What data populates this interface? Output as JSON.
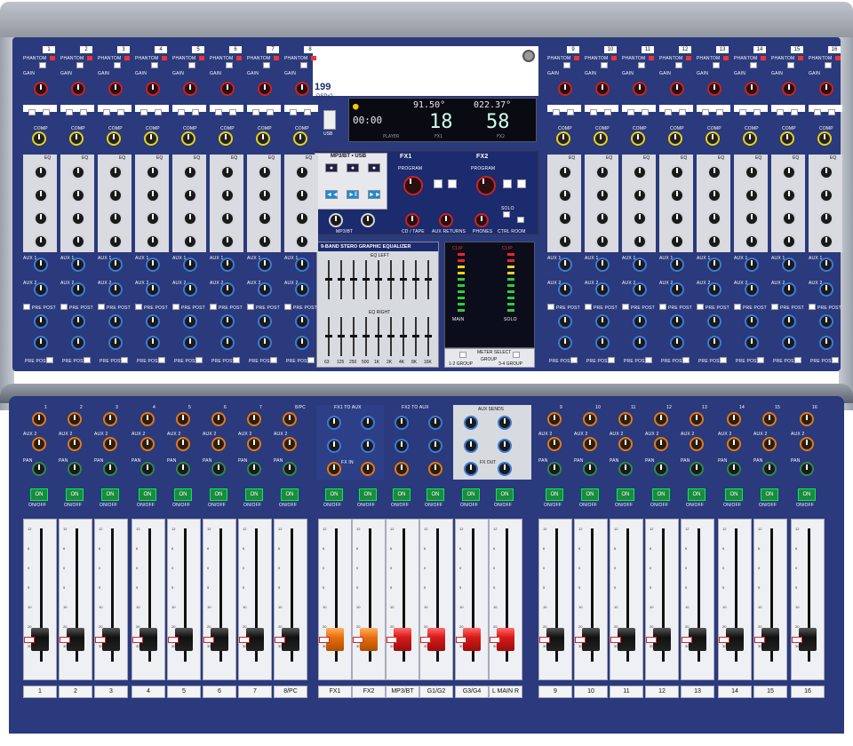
{
  "mixer": {
    "model": "199",
    "dsp_label": "DSPx2",
    "usb_label": "USB",
    "display": {
      "left_top": "91.50°",
      "right_top": "022.37°",
      "left_digits": "00:00",
      "big_left": "18",
      "big_right": "58",
      "player_label": "PLAYER",
      "fx1_label": "FX1",
      "fx2_label": "FX2"
    },
    "channels_top": [
      "1",
      "2",
      "3",
      "4",
      "5",
      "6",
      "7",
      "8"
    ],
    "channels_top_right": [
      "9",
      "10",
      "11",
      "12",
      "13",
      "14",
      "15",
      "16"
    ],
    "strip_labels": {
      "phantom": "PHANTOM",
      "gain": "GAIN",
      "comp": "COMP",
      "eq": "EQ",
      "aux1": "AUX 1",
      "aux2": "AUX 2",
      "pre_post": "PRE POST",
      "pan": "PAN",
      "on_off": "ON/OFF",
      "on": "ON",
      "solo": "SOLO",
      "main": "MAIN"
    },
    "center": {
      "mp3_title": "MP3/BT • USB",
      "fx1_title": "FX1",
      "fx2_title": "FX2",
      "program": "PROGRAM",
      "mp3_bt": "MP3/BT",
      "cd_tape": "CD / TAPE",
      "aux_returns": "AUX RETURNS",
      "phones": "PHONES",
      "ctrl_room": "CTRL ROOM",
      "solo": "SOLO",
      "geq_title": "9-BAND STERO GRAPHIC EQUALIZER",
      "eq_left": "EQ LEFT",
      "eq_right": "EQ RIGHT",
      "geq_bands": [
        "63",
        "125",
        "250",
        "500",
        "1K",
        "2K",
        "4K",
        "8K",
        "16K"
      ],
      "meter_select": "METER SELECT",
      "main": "MAIN",
      "solo_lbl": "SOLO",
      "group": "GROUP",
      "group_1_2": "1-2 GROUP",
      "group_3_4": "3-4 GROUP",
      "clip": "CLIP"
    },
    "bottom_center": {
      "fx1_to_aux": "FX1 TO AUX",
      "fx2_to_aux": "FX2 TO AUX",
      "aux_sends": "AUX SENDS",
      "fx_in": "FX IN",
      "fx_out": "FX OUT"
    },
    "fader_labels": [
      "1",
      "2",
      "3",
      "4",
      "5",
      "6",
      "7",
      "8/PC",
      "FX1",
      "FX2",
      "MP3/BT",
      "G1/G2",
      "G3/G4",
      "L MAIN R",
      "9",
      "10",
      "11",
      "12",
      "13",
      "14",
      "15",
      "16"
    ],
    "fader_caps": [
      "black",
      "black",
      "black",
      "black",
      "black",
      "black",
      "black",
      "black",
      "orange",
      "orange",
      "red",
      "red",
      "red",
      "red",
      "black",
      "black",
      "black",
      "black",
      "black",
      "black",
      "black",
      "black"
    ],
    "fader_levels": [
      0.17,
      0.17,
      0.17,
      0.17,
      0.17,
      0.17,
      0.17,
      0.17,
      0.17,
      0.17,
      0.17,
      0.17,
      0.17,
      0.17,
      0.17,
      0.17,
      0.17,
      0.17,
      0.17,
      0.17,
      0.17,
      0.17
    ],
    "scale_marks": [
      "12",
      "6",
      "0",
      "5",
      "10",
      "20",
      "30",
      "40",
      "∞"
    ],
    "pc_label": "PC"
  }
}
